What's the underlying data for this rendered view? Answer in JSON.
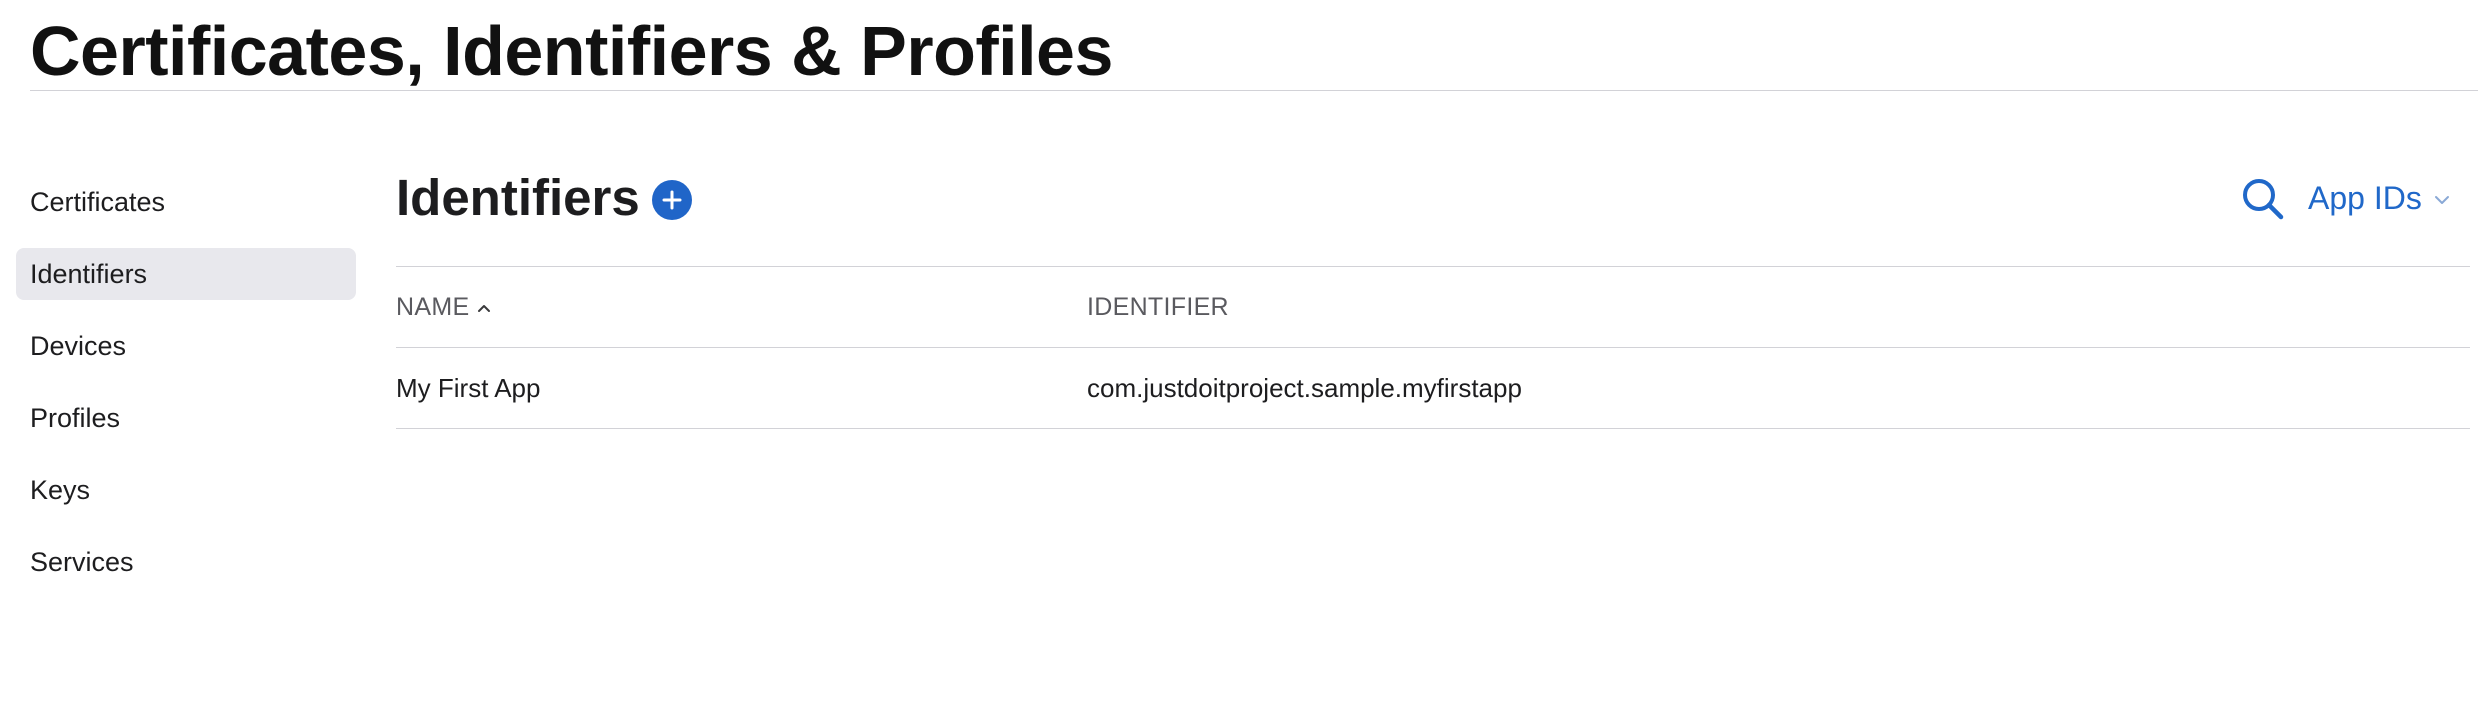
{
  "page": {
    "title": "Certificates, Identifiers & Profiles"
  },
  "sidebar": {
    "items": [
      {
        "label": "Certificates",
        "active": false
      },
      {
        "label": "Identifiers",
        "active": true
      },
      {
        "label": "Devices",
        "active": false
      },
      {
        "label": "Profiles",
        "active": false
      },
      {
        "label": "Keys",
        "active": false
      },
      {
        "label": "Services",
        "active": false
      }
    ]
  },
  "section": {
    "title": "Identifiers",
    "add_icon": "plus-circle-icon",
    "search_icon": "search-icon",
    "filter": {
      "selected": "App IDs",
      "icon": "chevron-down-icon"
    }
  },
  "table": {
    "columns": [
      {
        "label": "NAME",
        "sort": "ascending",
        "sort_icon": "chevron-up-icon"
      },
      {
        "label": "IDENTIFIER"
      }
    ],
    "rows": [
      {
        "name": "My First App",
        "identifier": "com.justdoitproject.sample.myfirstapp"
      }
    ]
  },
  "colors": {
    "accent": "#2065c8",
    "link": "#2068c9",
    "active_item_bg": "#e8e8ed",
    "rule": "#d2d2d7",
    "text": "#1d1d1f",
    "muted_text": "#5a5a5f"
  }
}
